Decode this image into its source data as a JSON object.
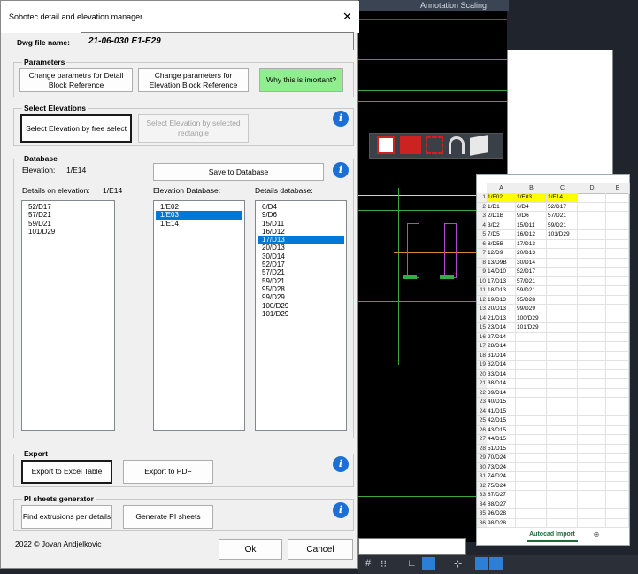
{
  "dialog": {
    "title": "Sobotec detail and elevation manager",
    "close_glyph": "✕",
    "dwg_label": "Dwg file name:",
    "dwg_value": "21-06-030 E1-E29",
    "parameters": {
      "label": "Parameters",
      "btn_detail": "Change parametrs for Detail Block Reference",
      "btn_elevation": "Change parameters for Elevation Block Reference",
      "btn_why": "Why this is imortant?"
    },
    "select_elevations": {
      "label": "Select Elevations",
      "btn_free": "Select Elevation by free select",
      "btn_rect": "Select Elevation by selected rectangle"
    },
    "database": {
      "label": "Database",
      "elevation_label": "Elevation:",
      "elevation_value": "1/E14",
      "save_button": "Save to Database",
      "details_on_elevation_label": "Details on elevation:",
      "details_on_elevation_value": "1/E14",
      "elevation_db_label": "Elevation Database:",
      "details_db_label": "Details database:",
      "details_on_elevation": [
        "52/D17",
        "57/D21",
        "59/D21",
        "101/D29"
      ],
      "elevation_db": [
        "1/E02",
        "1/E03",
        "1/E14"
      ],
      "elevation_db_selected": 1,
      "details_db": [
        "6/D4",
        "9/D6",
        "15/D11",
        "16/D12",
        "17/D13",
        "20/D13",
        "30/D14",
        "52/D17",
        "57/D21",
        "59/D21",
        "95/D28",
        "99/D29",
        "100/D29",
        "101/D29"
      ],
      "details_db_selected": 4
    },
    "export": {
      "label": "Export",
      "btn_excel": "Export to Excel Table",
      "btn_pdf": "Export to PDF"
    },
    "pi": {
      "label": "PI sheets generator",
      "btn_find": "Find extrusions per details",
      "btn_generate": "Generate PI sheets"
    },
    "footer": {
      "copyright": "2022 © Jovan Andjelkovic",
      "ok": "Ok",
      "cancel": "Cancel"
    },
    "info_glyph": "i"
  },
  "cad": {
    "top_text": "Annotation Scaling"
  },
  "excel": {
    "columns": [
      "A",
      "B",
      "C",
      "D",
      "E"
    ],
    "col_a": [
      "1/E02",
      "1/D1",
      "2/D1B",
      "3/D2",
      "7/D5",
      "8/D5B",
      "12/D9",
      "13/D9B",
      "14/D10",
      "17/D13",
      "18/D13",
      "19/D13",
      "20/D13",
      "21/D13",
      "23/D14",
      "27/D14",
      "28/D14",
      "31/D14",
      "32/D14",
      "33/D14",
      "38/D14",
      "39/D14",
      "40/D15",
      "41/D15",
      "42/D15",
      "43/D15",
      "44/D15",
      "51/D15",
      "70/D24",
      "73/D24",
      "74/D24",
      "75/D24",
      "87/D27",
      "88/D27",
      "96/D28",
      "98/D28"
    ],
    "col_b": [
      "1/E03",
      "6/D4",
      "9/D6",
      "15/D11",
      "16/D12",
      "17/D13",
      "20/D13",
      "30/D14",
      "52/D17",
      "57/D21",
      "59/D21",
      "95/D28",
      "99/D29",
      "100/D29",
      "101/D29"
    ],
    "col_c": [
      "1/E14",
      "52/D17",
      "57/D21",
      "59/D21",
      "101/D29"
    ],
    "sheet_tab": "Autocad Import",
    "add_sheet": "⊕",
    "highlight_color": "#ffff00"
  }
}
